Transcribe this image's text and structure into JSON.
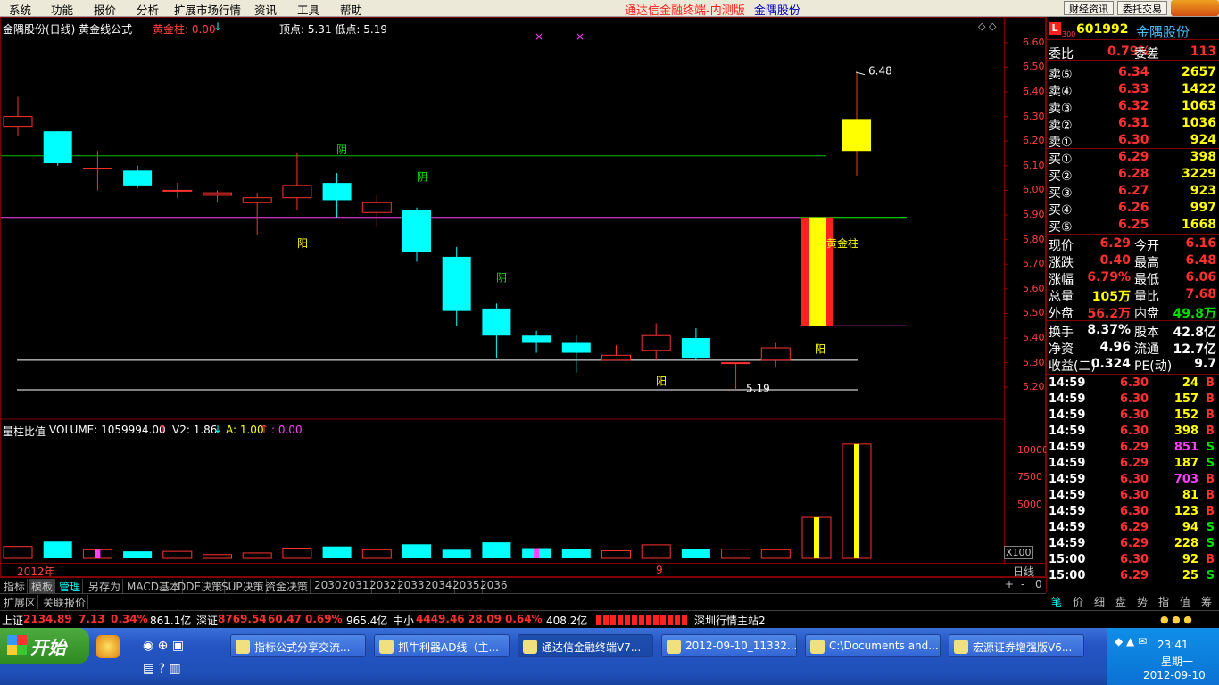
{
  "menu": [
    "系统",
    "功能",
    "报价",
    "分析",
    "扩展市场行情",
    "资讯",
    "工具",
    "帮助"
  ],
  "window_title": "通达信金融终端-内测版",
  "window_title_stock": "金隅股份",
  "top_buttons": [
    "财经资讯",
    "委托交易"
  ],
  "chart": {
    "header_name": "金隅股份(日线) 黄金线公式",
    "header_indicator": "黄金柱: 0.00",
    "header_arrow": "↓",
    "header_peak": "顶点: 5.31  低点: 5.19",
    "price_axis": [
      "6.60",
      "6.50",
      "6.40",
      "6.30",
      "6.20",
      "6.10",
      "6.00",
      "5.90",
      "5.80",
      "5.70",
      "5.60",
      "5.50",
      "5.40",
      "5.30",
      "5.20"
    ],
    "labels_yin": "阴",
    "labels_yang": "阳",
    "label_golden": "黄金柱",
    "high_marker": "6.48",
    "low_marker": "5.19",
    "volume_header_name": "量柱比值",
    "volume_header_vol": "VOLUME: 1059994.00",
    "volume_header_v2": "V2: 1.86",
    "volume_header_a": "A: 1.00",
    "volume_header_last": ": 0.00",
    "volume_axis": [
      "10000",
      "7500",
      "5000"
    ],
    "volume_unit": "X100",
    "date_year": "2012年",
    "date_month": "9",
    "period": "日线"
  },
  "chart_data": {
    "type": "candlestick",
    "candles": [
      {
        "o": 6.26,
        "h": 6.38,
        "l": 6.22,
        "c": 6.3
      },
      {
        "o": 6.24,
        "h": 6.24,
        "l": 6.1,
        "c": 6.11
      },
      {
        "o": 6.09,
        "h": 6.16,
        "l": 6.0,
        "c": 6.09
      },
      {
        "o": 6.08,
        "h": 6.1,
        "l": 6.01,
        "c": 6.02
      },
      {
        "o": 6.0,
        "h": 6.03,
        "l": 5.97,
        "c": 6.0
      },
      {
        "o": 5.98,
        "h": 6.0,
        "l": 5.95,
        "c": 5.99
      },
      {
        "o": 5.95,
        "h": 5.99,
        "l": 5.82,
        "c": 5.97
      },
      {
        "o": 5.97,
        "h": 6.15,
        "l": 5.92,
        "c": 6.02
      },
      {
        "o": 6.03,
        "h": 6.07,
        "l": 5.89,
        "c": 5.96
      },
      {
        "o": 5.91,
        "h": 5.98,
        "l": 5.85,
        "c": 5.95
      },
      {
        "o": 5.92,
        "h": 5.93,
        "l": 5.71,
        "c": 5.75
      },
      {
        "o": 5.73,
        "h": 5.77,
        "l": 5.45,
        "c": 5.51
      },
      {
        "o": 5.52,
        "h": 5.54,
        "l": 5.32,
        "c": 5.41
      },
      {
        "o": 5.41,
        "h": 5.43,
        "l": 5.34,
        "c": 5.38
      },
      {
        "o": 5.38,
        "h": 5.41,
        "l": 5.26,
        "c": 5.34
      },
      {
        "o": 5.31,
        "h": 5.37,
        "l": 5.31,
        "c": 5.33
      },
      {
        "o": 5.35,
        "h": 5.46,
        "l": 5.31,
        "c": 5.41
      },
      {
        "o": 5.4,
        "h": 5.44,
        "l": 5.31,
        "c": 5.32
      },
      {
        "o": 5.3,
        "h": 5.3,
        "l": 5.19,
        "c": 5.3
      },
      {
        "o": 5.31,
        "h": 5.38,
        "l": 5.28,
        "c": 5.36
      },
      {
        "o": 6.16,
        "h": 6.48,
        "l": 6.06,
        "c": 6.29
      }
    ],
    "volumes": [
      1100,
      1550,
      800,
      650,
      650,
      350,
      500,
      950,
      1100,
      800,
      1300,
      800,
      1480,
      950,
      900,
      700,
      1250,
      900,
      850,
      800,
      3800,
      10600
    ],
    "ylim": [
      5.15,
      6.65
    ],
    "vol_ylim": [
      0,
      11500
    ],
    "hlines": [
      {
        "y": 6.14,
        "color": "#00c000",
        "x1": 0,
        "x2": 925
      },
      {
        "y": 5.89,
        "color": "#ff40ff",
        "x1": 0,
        "x2": 895
      },
      {
        "y": 5.89,
        "color": "#00ff00",
        "x1": 895,
        "x2": 1015
      },
      {
        "y": 5.45,
        "color": "#ff40ff",
        "x1": 895,
        "x2": 1015
      },
      {
        "y": 5.31,
        "color": "#ffffff",
        "x1": 18,
        "x2": 960
      },
      {
        "y": 5.19,
        "color": "#ffffff",
        "x1": 18,
        "x2": 960
      }
    ]
  },
  "quote": {
    "code": "601992",
    "name": "金隅股份",
    "badge": "L",
    "badge_sub": "300",
    "webi": "财经资讯",
    "weibi": {
      "label": "委比",
      "value": "0.79%",
      "label2": "委差",
      "value2": "113"
    },
    "sells": [
      {
        "label": "卖⑤",
        "price": "6.34",
        "vol": "2657"
      },
      {
        "label": "卖④",
        "price": "6.33",
        "vol": "1422"
      },
      {
        "label": "卖③",
        "price": "6.32",
        "vol": "1063"
      },
      {
        "label": "卖②",
        "price": "6.31",
        "vol": "1036"
      },
      {
        "label": "卖①",
        "price": "6.30",
        "vol": "924"
      }
    ],
    "buys": [
      {
        "label": "买①",
        "price": "6.29",
        "vol": "398"
      },
      {
        "label": "买②",
        "price": "6.28",
        "vol": "3229"
      },
      {
        "label": "买③",
        "price": "6.27",
        "vol": "923"
      },
      {
        "label": "买④",
        "price": "6.26",
        "vol": "997"
      },
      {
        "label": "买⑤",
        "price": "6.25",
        "vol": "1668"
      }
    ],
    "stats": [
      {
        "l1": "现价",
        "v1": "6.29",
        "c1": "red",
        "l2": "今开",
        "v2": "6.16",
        "c2": "red"
      },
      {
        "l1": "涨跌",
        "v1": "0.40",
        "c1": "red",
        "l2": "最高",
        "v2": "6.48",
        "c2": "red"
      },
      {
        "l1": "涨幅",
        "v1": "6.79%",
        "c1": "red",
        "l2": "最低",
        "v2": "6.06",
        "c2": "red"
      },
      {
        "l1": "总量",
        "v1": "105万",
        "c1": "yellow",
        "l2": "量比",
        "v2": "7.68",
        "c2": "red"
      },
      {
        "l1": "外盘",
        "v1": "56.2万",
        "c1": "red",
        "l2": "内盘",
        "v2": "49.8万",
        "c2": "green"
      },
      {
        "l1": "换手",
        "v1": "8.37%",
        "c1": "white",
        "l2": "股本",
        "v2": "42.8亿",
        "c2": "white"
      },
      {
        "l1": "净资",
        "v1": "4.96",
        "c1": "white",
        "l2": "流通",
        "v2": "12.7亿",
        "c2": "white"
      },
      {
        "l1": "收益(二)",
        "v1": "0.324",
        "c1": "white",
        "l2": "PE(动)",
        "v2": "9.7",
        "c2": "white"
      }
    ],
    "ticks": [
      {
        "t": "14:59",
        "p": "6.30",
        "v": "24",
        "s": "B"
      },
      {
        "t": "14:59",
        "p": "6.30",
        "v": "157",
        "s": "B"
      },
      {
        "t": "14:59",
        "p": "6.30",
        "v": "152",
        "s": "B"
      },
      {
        "t": "14:59",
        "p": "6.30",
        "v": "398",
        "s": "B"
      },
      {
        "t": "14:59",
        "p": "6.29",
        "v": "851",
        "s": "S"
      },
      {
        "t": "14:59",
        "p": "6.29",
        "v": "187",
        "s": "S"
      },
      {
        "t": "14:59",
        "p": "6.30",
        "v": "703",
        "s": "B"
      },
      {
        "t": "14:59",
        "p": "6.30",
        "v": "81",
        "s": "B"
      },
      {
        "t": "14:59",
        "p": "6.30",
        "v": "123",
        "s": "B"
      },
      {
        "t": "14:59",
        "p": "6.29",
        "v": "94",
        "s": "S"
      },
      {
        "t": "14:59",
        "p": "6.29",
        "v": "228",
        "s": "S"
      },
      {
        "t": "15:00",
        "p": "6.30",
        "v": "92",
        "s": "B"
      },
      {
        "t": "15:00",
        "p": "6.29",
        "v": "25",
        "s": "S"
      }
    ],
    "panel_tabs": [
      "笔",
      "价",
      "细",
      "盘",
      "势",
      "指",
      "值",
      "筹"
    ]
  },
  "bottom_tabs": [
    "指标",
    "模板",
    "管理",
    "另存为",
    "MACD基本",
    "DDE决策",
    "SUP决策",
    "资金决策",
    "2030",
    "2031",
    "2032",
    "2033",
    "2034",
    "2035",
    "2036"
  ],
  "bottom_tabs2": [
    "扩展区",
    "关联报价"
  ],
  "zoom_controls": [
    "+",
    "-",
    "0"
  ],
  "index_bar": {
    "sh_label": "上证",
    "sh_val": "2134.89",
    "sh_chg": "7.13",
    "sh_pct": "0.34%",
    "sh_amt": "861.1亿",
    "sz_label": "深证",
    "sz_val": "8769.54",
    "sz_chg": "60.47",
    "sz_pct": "0.69%",
    "sz_amt": "965.4亿",
    "zx_label": "中小",
    "zx_val": "4449.46",
    "zx_chg": "28.09",
    "zx_pct": "0.64%",
    "zx_amt": "408.2亿",
    "server": "深圳行情主站2"
  },
  "taskbar": {
    "start": "开始",
    "tasks": [
      "指标公式分享交流...",
      "抓牛利器AD线（主...",
      "通达信金融终端V7...",
      "2012-09-10_11332...",
      "C:\\Documents and...",
      "宏源证券增强版V6..."
    ],
    "time": "23:41",
    "weekday": "星期一",
    "date": "2012-09-10"
  },
  "colors": {
    "up": "#ff3030",
    "down": "#00ffff",
    "golden": "#ffff00",
    "bg": "#000000",
    "border": "#800000"
  }
}
